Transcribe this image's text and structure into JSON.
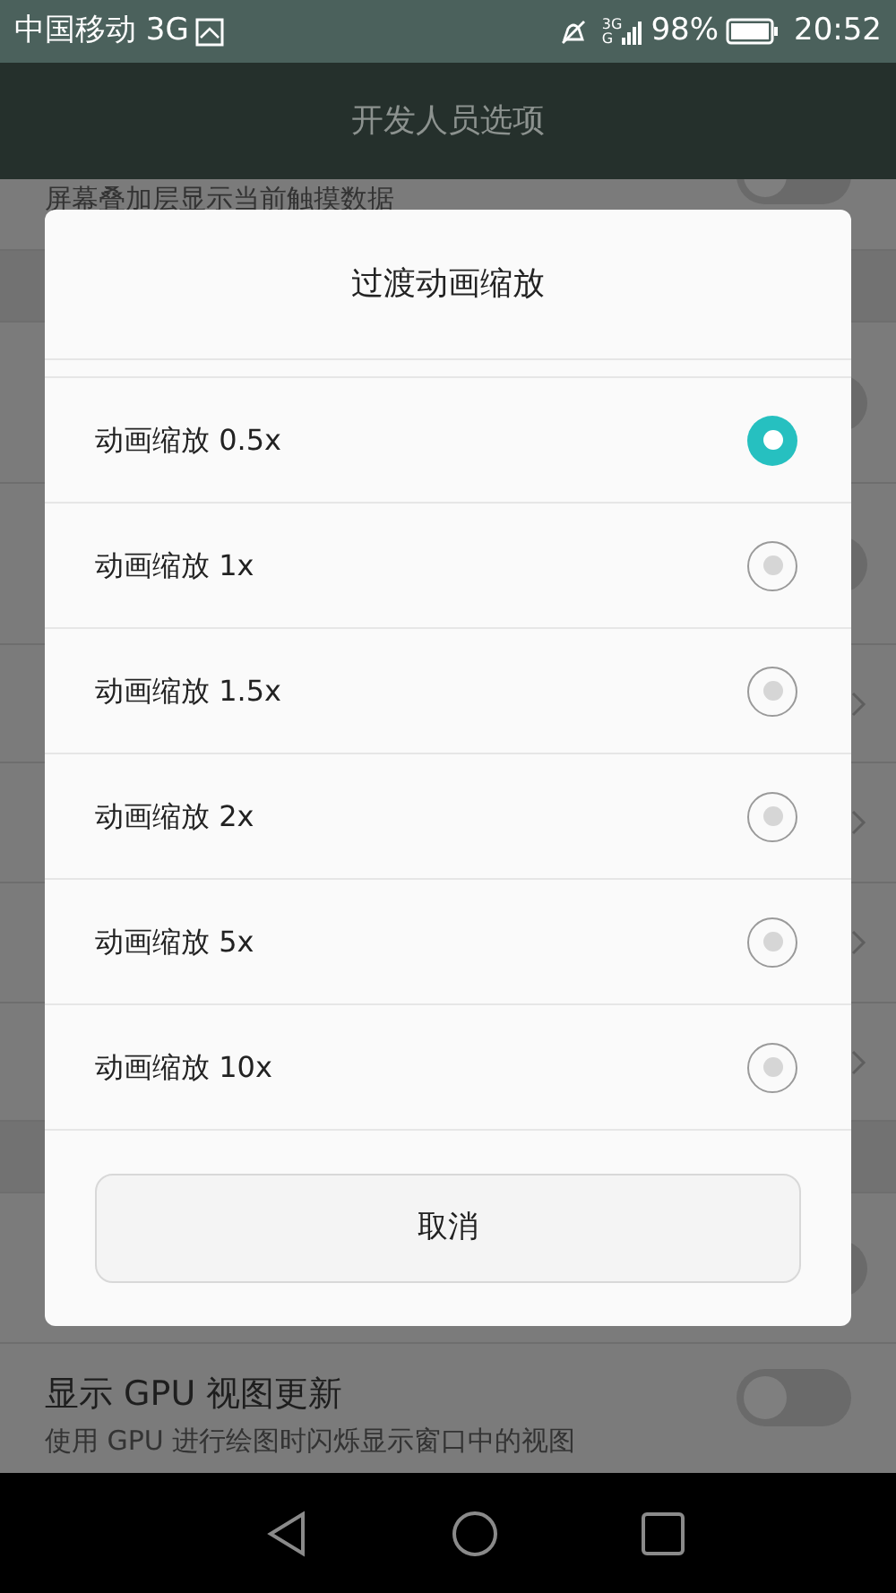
{
  "status_bar": {
    "carrier": "中国移动 3G",
    "network_top": "3G",
    "network_bottom": "G",
    "battery": "98%",
    "time": "20:52"
  },
  "title_bar": {
    "title": "开发人员选项"
  },
  "settings": [
    {
      "kind": "toggle",
      "subtitle": "屏幕叠加层显示当前触摸数据",
      "on": false
    },
    {
      "kind": "section"
    },
    {
      "kind": "toggle",
      "on": false
    },
    {
      "kind": "toggle",
      "on": false
    },
    {
      "kind": "chevron"
    },
    {
      "kind": "chevron"
    },
    {
      "kind": "chevron"
    },
    {
      "kind": "chevron"
    },
    {
      "kind": "section"
    },
    {
      "kind": "toggle",
      "on": false
    },
    {
      "kind": "toggle",
      "title": "显示 GPU 视图更新",
      "subtitle": "使用 GPU 进行绘图时闪烁显示窗口中的视图",
      "on": false
    }
  ],
  "dialog": {
    "title": "过渡动画缩放",
    "options": [
      {
        "label": "动画缩放 0.5x",
        "selected": true
      },
      {
        "label": "动画缩放 1x",
        "selected": false
      },
      {
        "label": "动画缩放 1.5x",
        "selected": false
      },
      {
        "label": "动画缩放 2x",
        "selected": false
      },
      {
        "label": "动画缩放 5x",
        "selected": false
      },
      {
        "label": "动画缩放 10x",
        "selected": false
      }
    ],
    "cancel": "取消"
  }
}
